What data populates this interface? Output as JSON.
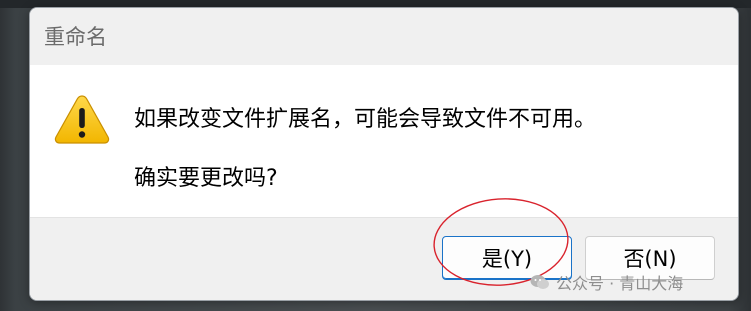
{
  "dialog": {
    "title": "重命名",
    "icon": "warning-icon",
    "message": "如果改变文件扩展名，可能会导致文件不可用。",
    "question": "确实要更改吗?",
    "buttons": {
      "yes_label": "是(Y)",
      "no_label": "否(N)"
    }
  },
  "watermark": {
    "text": "公众号 · 青山大海"
  },
  "colors": {
    "warning_fill": "#F9C21A",
    "accent_border": "#1A73C8",
    "annotation_circle": "#D9232D"
  }
}
